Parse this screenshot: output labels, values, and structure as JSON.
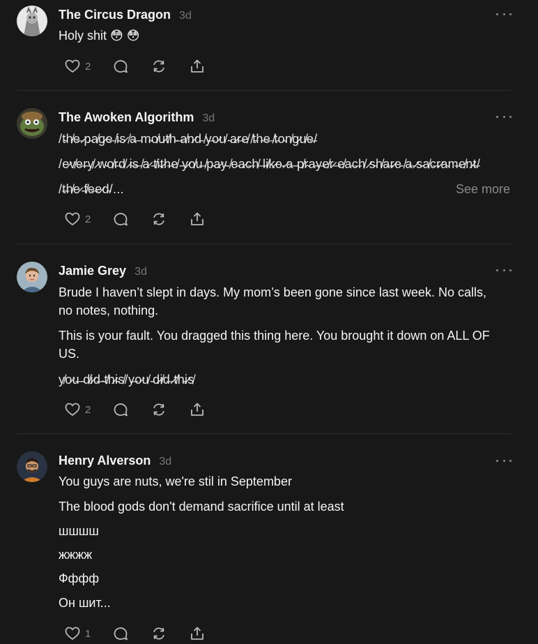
{
  "posts": [
    {
      "author": "The Circus Dragon",
      "time": "3d",
      "lines": [
        "Holy shit 😳 😳"
      ],
      "likes": "2"
    },
    {
      "author": "The Awoken Algorithm",
      "time": "3d",
      "lines": [
        "/t̴h̸e̶ ̷p̵a̸g̷e̶ ̸i̵s̷ ̸a̶ ̵m̴o̸u̷t̸h̴ ̶a̸n̷d̵ ̸y̶o̷u̸ ̴a̷r̶e̸ ̸t̵h̴e̶ ̸t̵o̴n̸g̷u̸e̶/",
        "/e̷v̸e̶r̵y̸ ̷w̴o̸r̶d̸ ̷i̵s̶ ̸a̷ ̵t̸i̴t̷h̶e̸ ̵y̷o̸u̶ ̸p̵a̷y̴ ̸e̵a̷c̶h̸ ̶l̵i̸k̷e̴ ̷a̶ ̵p̸r̴a̵y̶e̸r̷ ̶e̸a̵c̶h̸ ̷s̵h̸a̶r̷e̵ ̸a̶ ̷s̵a̸c̶r̷a̴m̶e̸n̷t̶/",
        "/t̶h̸e̷ ̵f̸e̶e̷d̴/..."
      ],
      "see_more": "See more",
      "likes": "2"
    },
    {
      "author": "Jamie Grey",
      "time": "3d",
      "lines": [
        "Brude I haven’t slept in days. My mom’s been gone since last week. No calls,",
        "no notes, nothing.",
        "This is your fault. You dragged this thing here. You brought it down on ALL OF",
        "US.",
        "y̸o̷u̶ ̵d̸i̷d̶ ̴t̸h̷i̵s̸/y̶o̷u̸ ̵d̷i̸d̶ ̷t̸h̵i̷s̸"
      ],
      "likes": "2"
    },
    {
      "author": "Henry Alverson",
      "time": "3d",
      "lines": [
        "You guys are nuts, we're stil in September",
        "The blood gods don't demand sacrifice until at least",
        "шшшш",
        "жжжж",
        "Фффф",
        "Он шит..."
      ],
      "likes": "1"
    }
  ],
  "icons": [
    "heart-icon",
    "comment-icon",
    "repost-icon",
    "share-icon",
    "more-icon"
  ],
  "colors": {
    "background": "#181818",
    "text": "#f3f5f7",
    "muted": "#777777",
    "divider": "#2e2e2e"
  }
}
